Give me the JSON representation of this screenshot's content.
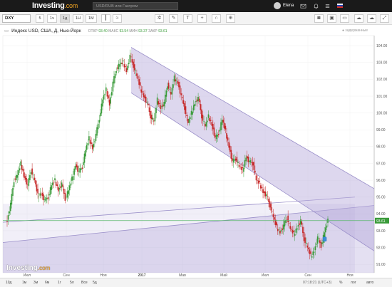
{
  "header": {
    "logo_main": "Investing",
    "logo_suffix": ".com",
    "search_placeholder": "USD/RUB или Газпром",
    "user_name": "Elena"
  },
  "toolbar": {
    "symbol": "DXY",
    "timeframes": [
      "5",
      "1ч",
      "1д",
      "1Н",
      "1М"
    ],
    "active_timeframe": "1д",
    "tool_icons": [
      "candles-icon",
      "indicators-icon",
      "settings-icon",
      "drawing-icon",
      "text-icon",
      "crosshair-icon",
      "magnet-icon",
      "zoom-icon"
    ],
    "right_icons": [
      "camera-icon",
      "color-icon",
      "layout-icon",
      "cloud-save-icon",
      "cloud-load-icon",
      "fullscreen-icon"
    ]
  },
  "legend": {
    "title": "Индекс USD, США, Д, Нью-Йорк",
    "open_label": "ОТКР",
    "open": "93.40",
    "high_label": "МАКС",
    "high": "93.54",
    "low_label": "МИН",
    "low": "93.37",
    "close_label": "ЗАКР",
    "close": "93.61",
    "delayed": "задержанные"
  },
  "chart_data": {
    "type": "candlestick",
    "y_ticks": [
      "104.00",
      "103.00",
      "102.00",
      "101.00",
      "100.00",
      "99.00",
      "98.00",
      "97.00",
      "96.00",
      "95.00",
      "94.00",
      "93.00",
      "92.00",
      "91.00"
    ],
    "ylim": [
      90.5,
      104.6
    ],
    "x_ticks": [
      "Июл",
      "Сен",
      "Ноя",
      "2017",
      "Мар",
      "Май",
      "Июл",
      "Сен",
      "Ноя"
    ],
    "current_price": "93.61",
    "horizontal_line": 93.6,
    "channels": [
      {
        "name": "descending",
        "upper": [
          [
            184,
            103.9
          ],
          [
            525,
            95.5
          ]
        ],
        "lower": [
          [
            184,
            101.2
          ],
          [
            525,
            91.8
          ]
        ]
      },
      {
        "name": "ascending",
        "upper": [
          [
            5,
            92.3
          ],
          [
            525,
            94.5
          ]
        ],
        "base": [
          [
            5,
            93.5
          ],
          [
            498,
            94.0
          ]
        ]
      }
    ],
    "series": [
      {
        "name": "DXY",
        "values": [
          93.6,
          94.6,
          96.0,
          96.3,
          97.0,
          96.2,
          95.7,
          96.6,
          96.0,
          95.1,
          95.2,
          94.8,
          95.0,
          95.7,
          96.0,
          95.4,
          95.8,
          94.9,
          95.4,
          96.1,
          96.9,
          96.5,
          96.8,
          97.8,
          98.5,
          97.9,
          98.7,
          99.7,
          100.8,
          101.4,
          100.5,
          101.8,
          102.6,
          102.9,
          103.0,
          102.5,
          103.4,
          102.8,
          102.2,
          101.5,
          101.0,
          100.6,
          99.8,
          99.5,
          100.8,
          100.3,
          100.6,
          101.7,
          101.1,
          102.1,
          101.8,
          101.0,
          100.3,
          99.4,
          100.0,
          100.6,
          100.9,
          99.8,
          99.2,
          99.8,
          99.3,
          98.5,
          98.8,
          99.6,
          98.9,
          98.0,
          97.1,
          97.3,
          96.8,
          96.6,
          97.4,
          97.1,
          97.0,
          96.0,
          95.8,
          95.3,
          95.1,
          94.5,
          93.8,
          93.2,
          92.9,
          93.3,
          93.8,
          93.1,
          92.8,
          93.2,
          93.6,
          92.5,
          92.0,
          91.5,
          91.8,
          92.6,
          92.1,
          92.9,
          93.6
        ]
      }
    ]
  },
  "watermark": {
    "main": "Investing",
    "suffix": ".com"
  },
  "bottom": {
    "ranges": [
      "10д",
      "1м",
      "3м",
      "6м",
      "1г",
      "5л",
      "Bce",
      "5д"
    ],
    "time": "07:18:21 (UTC+3)",
    "options": [
      "%",
      "лог",
      "авто"
    ]
  },
  "colors": {
    "up": "#3a9b3a",
    "down": "#c62828",
    "channel_fill": "#b3a6d9",
    "channel_line": "#9a8fc9",
    "hline": "#5ab86b",
    "price_label_bg": "#3a9b3a",
    "topbar": "#1a1a1a"
  }
}
